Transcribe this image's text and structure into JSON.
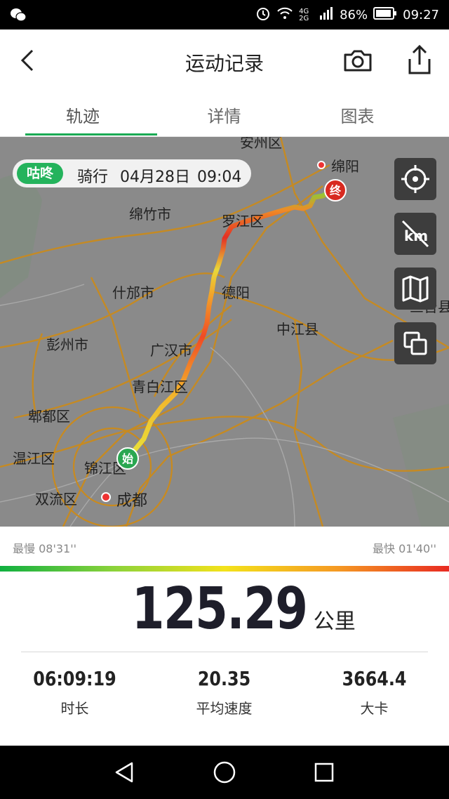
{
  "status_bar": {
    "battery": "86%",
    "time": "09:27",
    "network": "4G 2G"
  },
  "header": {
    "title": "运动记录"
  },
  "tabs": [
    {
      "label": "轨迹"
    },
    {
      "label": "详情"
    },
    {
      "label": "图表"
    }
  ],
  "active_tab": "轨迹",
  "map": {
    "labels": {
      "anzhou": "安州区",
      "mianyang": "绵阳",
      "mianzhu": "绵竹市",
      "luojiang": "罗江区",
      "shifang": "什邡市",
      "deyang": "德阳",
      "zhongjiang": "中江县",
      "pengzhou": "彭州市",
      "guanghan": "广汉市",
      "qingbaijiang": "青白江区",
      "pidu": "郫都区",
      "wenjiang": "温江区",
      "jinjiang": "锦江区",
      "shuangliu": "双流区",
      "chengdu": "成都",
      "santai": "三台县"
    },
    "activity_tag": "咕咚",
    "activity_type": "骑行",
    "activity_date": "04月28日",
    "activity_time": "09:04",
    "start_marker": "始",
    "end_marker": "终",
    "controls": [
      "locate-icon",
      "km-off-icon",
      "map-style-icon",
      "layers-icon"
    ]
  },
  "speed": {
    "slowest": "最慢 08'31''",
    "fastest": "最快 01'40''"
  },
  "colors": {
    "accent": "#1aaa54",
    "slow": "#10b040",
    "fast": "#e82a22",
    "map_bg": "#8a8a8a",
    "road": "#c98a1e"
  },
  "summary": {
    "distance": "125.29",
    "distance_unit": "公里",
    "stats": [
      {
        "value": "06:09:19",
        "label": "时长"
      },
      {
        "value": "20.35",
        "label": "平均速度"
      },
      {
        "value": "3664.4",
        "label": "大卡"
      }
    ]
  }
}
